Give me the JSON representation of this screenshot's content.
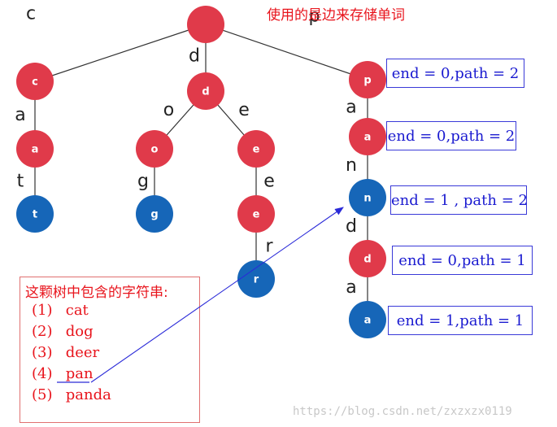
{
  "header": "使用的是边来存储单词",
  "nodes": [
    {
      "id": "root",
      "label": "",
      "color": "#e03a4a"
    },
    {
      "id": "c",
      "label": "c",
      "color": "#e03a4a"
    },
    {
      "id": "ca",
      "label": "a",
      "color": "#e03a4a"
    },
    {
      "id": "cat",
      "label": "t",
      "color": "#1666b8"
    },
    {
      "id": "d",
      "label": "d",
      "color": "#e03a4a"
    },
    {
      "id": "do",
      "label": "o",
      "color": "#e03a4a"
    },
    {
      "id": "dog",
      "label": "g",
      "color": "#1666b8"
    },
    {
      "id": "de",
      "label": "e",
      "color": "#e03a4a"
    },
    {
      "id": "dee",
      "label": "e",
      "color": "#e03a4a"
    },
    {
      "id": "deer",
      "label": "r",
      "color": "#1666b8"
    },
    {
      "id": "p",
      "label": "p",
      "color": "#e03a4a"
    },
    {
      "id": "pa",
      "label": "a",
      "color": "#e03a4a"
    },
    {
      "id": "pan",
      "label": "n",
      "color": "#1666b8"
    },
    {
      "id": "pand",
      "label": "d",
      "color": "#e03a4a"
    },
    {
      "id": "panda",
      "label": "a",
      "color": "#1666b8"
    }
  ],
  "edges": [
    {
      "from": "root",
      "to": "c",
      "label": "c"
    },
    {
      "from": "c",
      "to": "ca",
      "label": "a"
    },
    {
      "from": "ca",
      "to": "cat",
      "label": "t"
    },
    {
      "from": "root",
      "to": "d",
      "label": "d"
    },
    {
      "from": "d",
      "to": "do",
      "label": "o"
    },
    {
      "from": "do",
      "to": "dog",
      "label": "g"
    },
    {
      "from": "d",
      "to": "de",
      "label": "e"
    },
    {
      "from": "de",
      "to": "dee",
      "label": "e"
    },
    {
      "from": "dee",
      "to": "deer",
      "label": "r"
    },
    {
      "from": "root",
      "to": "p",
      "label": "p"
    },
    {
      "from": "p",
      "to": "pa",
      "label": "a"
    },
    {
      "from": "pa",
      "to": "pan",
      "label": "n"
    },
    {
      "from": "pan",
      "to": "pand",
      "label": "d"
    },
    {
      "from": "pand",
      "to": "panda",
      "label": "a"
    }
  ],
  "info_boxes": [
    {
      "node": "p",
      "text": "end = 0,path = 2"
    },
    {
      "node": "pa",
      "text": "end = 0,path = 2"
    },
    {
      "node": "pan",
      "text": "end = 1 , path = 2"
    },
    {
      "node": "pand",
      "text": "end = 0,path = 1"
    },
    {
      "node": "panda",
      "text": "end = 1,path = 1"
    }
  ],
  "strings_box": {
    "title": "这颗树中包含的字符串:",
    "items": [
      {
        "num": "(1)",
        "word": "cat"
      },
      {
        "num": "(2)",
        "word": "dog"
      },
      {
        "num": "(3)",
        "word": "deer"
      },
      {
        "num": "(4)",
        "word": "pan"
      },
      {
        "num": "(5)",
        "word": "panda"
      }
    ]
  },
  "watermark": "https://blog.csdn.net/zxzxzx0119",
  "colors": {
    "accent_red": "#e8141c",
    "node_red": "#e03a4a",
    "node_blue": "#1666b8",
    "box_blue": "#3a3ad8",
    "arrow": "#2a2ad8"
  }
}
